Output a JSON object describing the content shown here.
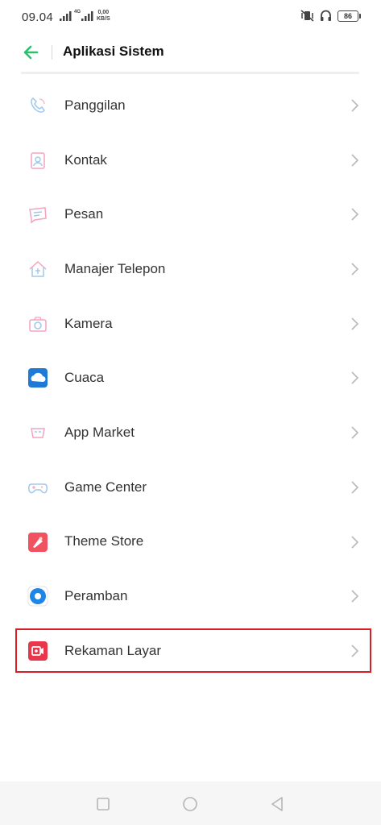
{
  "status_bar": {
    "time": "09.04",
    "net_type": "4G",
    "speed_value": "0,00",
    "speed_unit": "KB/S",
    "battery": "86"
  },
  "header": {
    "title": "Aplikasi Sistem"
  },
  "items": [
    {
      "label": "Panggilan",
      "icon": "phone-icon"
    },
    {
      "label": "Kontak",
      "icon": "contacts-icon"
    },
    {
      "label": "Pesan",
      "icon": "message-icon"
    },
    {
      "label": "Manajer Telepon",
      "icon": "phone-manager-icon"
    },
    {
      "label": "Kamera",
      "icon": "camera-icon"
    },
    {
      "label": "Cuaca",
      "icon": "weather-icon"
    },
    {
      "label": "App Market",
      "icon": "app-market-icon"
    },
    {
      "label": "Game Center",
      "icon": "gamepad-icon"
    },
    {
      "label": "Theme Store",
      "icon": "theme-store-icon"
    },
    {
      "label": "Peramban",
      "icon": "browser-icon"
    },
    {
      "label": "Rekaman Layar",
      "icon": "screen-recorder-icon"
    }
  ],
  "colors": {
    "accent": "#2bbf6e",
    "highlight": "#d81f26"
  }
}
